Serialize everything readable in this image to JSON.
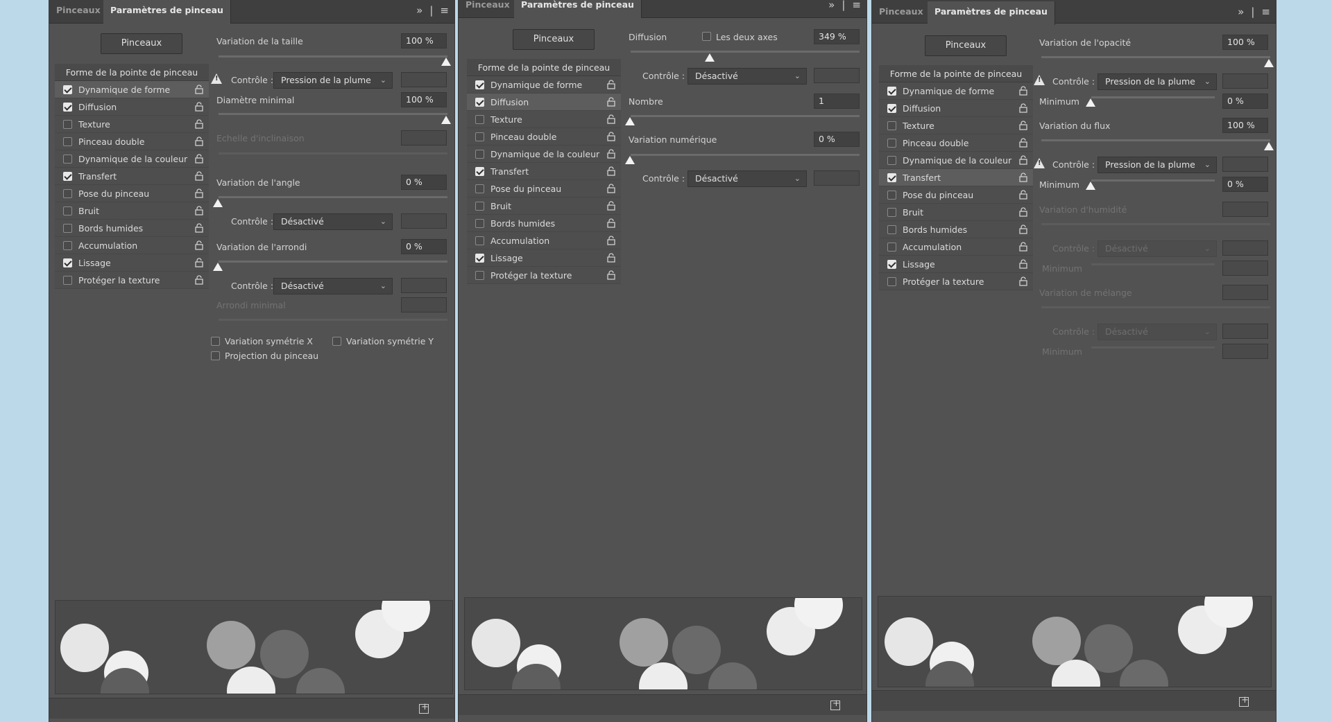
{
  "panels": [
    {
      "tabs": [
        "Pinceaux",
        "Paramètres de pinceau"
      ],
      "brushes_button": "Pinceaux",
      "list_header": "Forme de la pointe de pinceau",
      "items": [
        {
          "label": "Dynamique de forme",
          "checked": true
        },
        {
          "label": "Diffusion",
          "checked": true
        },
        {
          "label": "Texture",
          "checked": false
        },
        {
          "label": "Pinceau double",
          "checked": false
        },
        {
          "label": "Dynamique de la couleur",
          "checked": false
        },
        {
          "label": "Transfert",
          "checked": true
        },
        {
          "label": "Pose du pinceau",
          "checked": false
        },
        {
          "label": "Bruit",
          "checked": false
        },
        {
          "label": "Bords humides",
          "checked": false
        },
        {
          "label": "Accumulation",
          "checked": false
        },
        {
          "label": "Lissage",
          "checked": true
        },
        {
          "label": "Protéger la texture",
          "checked": false
        }
      ],
      "size_jitter_label": "Variation de la taille",
      "size_jitter_value": "100 %",
      "control_label": "Contrôle :",
      "control1_value": "Pression de la plume",
      "min_diameter_label": "Diamètre minimal",
      "min_diameter_value": "100 %",
      "tilt_scale_label": "Echelle d'inclinaison",
      "angle_jitter_label": "Variation de l'angle",
      "angle_jitter_value": "0 %",
      "control2_value": "Désactivé",
      "roundness_jitter_label": "Variation de l'arrondi",
      "roundness_jitter_value": "0 %",
      "control3_value": "Désactivé",
      "min_roundness_label": "Arrondi minimal",
      "flip_x_label": "Variation symétrie X",
      "flip_y_label": "Variation symétrie Y",
      "projection_label": "Projection du pinceau"
    },
    {
      "tabs": [
        "Pinceaux",
        "Paramètres de pinceau"
      ],
      "brushes_button": "Pinceaux",
      "list_header": "Forme de la pointe de pinceau",
      "items": [
        {
          "label": "Dynamique de forme",
          "checked": true
        },
        {
          "label": "Diffusion",
          "checked": true
        },
        {
          "label": "Texture",
          "checked": false
        },
        {
          "label": "Pinceau double",
          "checked": false
        },
        {
          "label": "Dynamique de la couleur",
          "checked": false
        },
        {
          "label": "Transfert",
          "checked": true
        },
        {
          "label": "Pose du pinceau",
          "checked": false
        },
        {
          "label": "Bruit",
          "checked": false
        },
        {
          "label": "Bords humides",
          "checked": false
        },
        {
          "label": "Accumulation",
          "checked": false
        },
        {
          "label": "Lissage",
          "checked": true
        },
        {
          "label": "Protéger la texture",
          "checked": false
        }
      ],
      "scatter_label": "Diffusion",
      "both_axes_label": "Les deux axes",
      "scatter_value": "349 %",
      "control_label": "Contrôle :",
      "control1_value": "Désactivé",
      "count_label": "Nombre",
      "count_value": "1",
      "count_jitter_label": "Variation numérique",
      "count_jitter_value": "0 %",
      "control2_value": "Désactivé"
    },
    {
      "tabs": [
        "Pinceaux",
        "Paramètres de pinceau"
      ],
      "brushes_button": "Pinceaux",
      "list_header": "Forme de la pointe de pinceau",
      "items": [
        {
          "label": "Dynamique de forme",
          "checked": true
        },
        {
          "label": "Diffusion",
          "checked": true
        },
        {
          "label": "Texture",
          "checked": false
        },
        {
          "label": "Pinceau double",
          "checked": false
        },
        {
          "label": "Dynamique de la couleur",
          "checked": false
        },
        {
          "label": "Transfert",
          "checked": true
        },
        {
          "label": "Pose du pinceau",
          "checked": false
        },
        {
          "label": "Bruit",
          "checked": false
        },
        {
          "label": "Bords humides",
          "checked": false
        },
        {
          "label": "Accumulation",
          "checked": false
        },
        {
          "label": "Lissage",
          "checked": true
        },
        {
          "label": "Protéger la texture",
          "checked": false
        }
      ],
      "opacity_jitter_label": "Variation de l'opacité",
      "opacity_jitter_value": "100 %",
      "control_label": "Contrôle :",
      "control1_value": "Pression de la plume",
      "minimum_label": "Minimum",
      "minimum1_value": "0 %",
      "flow_jitter_label": "Variation du flux",
      "flow_jitter_value": "100 %",
      "control2_value": "Pression de la plume",
      "minimum2_value": "0 %",
      "wetness_jitter_label": "Variation d'humidité",
      "control3_value": "Désactivé",
      "mix_jitter_label": "Variation de mélange",
      "control4_value": "Désactivé"
    }
  ]
}
